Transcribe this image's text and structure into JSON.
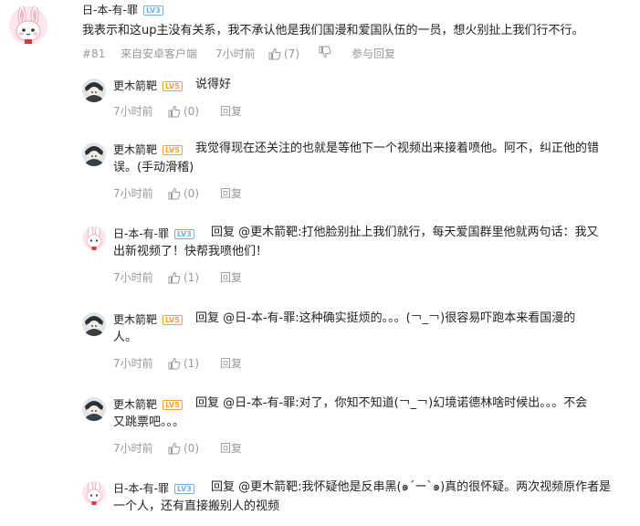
{
  "main_comment": {
    "username": "日-本-有-罪",
    "level": "LV3",
    "text": "我表示和这up主没有关系，我不承认他是我们国漫和爱国队伍的一员，想火别扯上我们行不行。",
    "floor": "#81",
    "source": "来自安卓客户端",
    "time": "7小时前",
    "likes": "(7)",
    "reply_label": "参与回复"
  },
  "replies": [
    {
      "username": "更木箭靶",
      "level": "LV5",
      "line1": "说得好",
      "line2": "",
      "time": "7小时前",
      "likes": "(0)",
      "reply_label": "回复"
    },
    {
      "username": "更木箭靶",
      "level": "LV5",
      "line1": "我觉得现在还关注的也就是等他下一个视频出来接着喷他。阿不，纠正他的错",
      "line2": "误。(手动滑稽)",
      "time": "7小时前",
      "likes": "(0)",
      "reply_label": "回复"
    },
    {
      "username": "日-本-有-罪",
      "level": "LV3",
      "line1": "回复 @更木箭靶:打他脸别扯上我们就行，每天爱国群里他就两句话：我又",
      "line2": "出新视频了！快帮我喷他们！",
      "time": "7小时前",
      "likes": "(1)",
      "reply_label": "回复"
    },
    {
      "username": "更木箭靶",
      "level": "LV5",
      "line1": "回复 @日-本-有-罪:这种确实挺烦的。。。(￢_￢)很容易吓跑本来看国漫的",
      "line2": "人。",
      "time": "7小时前",
      "likes": "(1)",
      "reply_label": "回复"
    },
    {
      "username": "更木箭靶",
      "level": "LV5",
      "line1": "回复 @日-本-有-罪:对了，你知不知道(￢_￢)幻境诺德林啥时候出。。。不会",
      "line2": "又跳票吧。。。",
      "time": "7小时前",
      "likes": "(0)",
      "reply_label": "回复"
    },
    {
      "username": "日-本-有-罪",
      "level": "LV3",
      "line1": "回复 @更木箭靶:我怀疑他是反串黑(๑´ー`๑)真的很怀疑。两次视频原作者是",
      "line2": "一个人，还有直接搬别人的视频",
      "time": "",
      "likes": "",
      "reply_label": ""
    }
  ],
  "colors": {
    "level_blue": "#6fb1e4",
    "level_orange": "#f3a034",
    "meta_gray": "#999999"
  }
}
